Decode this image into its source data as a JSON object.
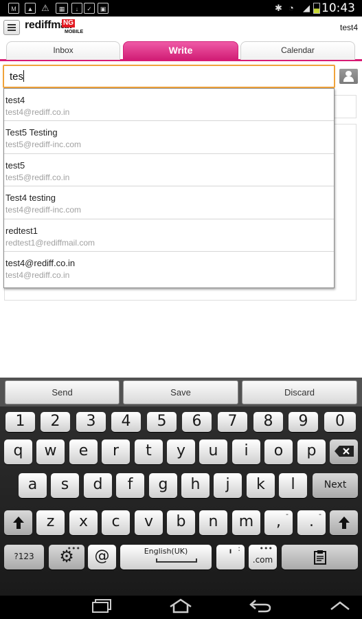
{
  "status_bar": {
    "time": "10:43",
    "icons_left": [
      "gmail-icon",
      "image-icon",
      "warning-icon",
      "keyboard-icon",
      "download-icon",
      "store-icon"
    ],
    "icons_right": [
      "bluetooth-icon",
      "wifi-icon",
      "signal-icon",
      "battery-icon"
    ]
  },
  "app": {
    "logo_text": "rediffmail",
    "logo_badge": "NG",
    "logo_sub": "MOBILE",
    "user": "test4",
    "brand_color": "#d81b74"
  },
  "tabs": [
    {
      "label": "Inbox",
      "active": false
    },
    {
      "label": "Write",
      "active": true
    },
    {
      "label": "Calendar",
      "active": false
    }
  ],
  "compose": {
    "to_value": "tes"
  },
  "suggestions": [
    {
      "name": "test4",
      "email": "test4@rediff.co.in"
    },
    {
      "name": "Test5 Testing",
      "email": "test5@rediff-inc.com"
    },
    {
      "name": "test5",
      "email": "test5@rediff.co.in"
    },
    {
      "name": "Test4 testing",
      "email": "test4@rediff-inc.com"
    },
    {
      "name": "redtest1",
      "email": "redtest1@rediffmail.com"
    },
    {
      "name": "test4@rediff.co.in",
      "email": "test4@rediff.co.in"
    }
  ],
  "actions": {
    "send": "Send",
    "save": "Save",
    "discard": "Discard"
  },
  "keyboard": {
    "row1": [
      "1",
      "2",
      "3",
      "4",
      "5",
      "6",
      "7",
      "8",
      "9",
      "0"
    ],
    "row2": [
      "q",
      "w",
      "e",
      "r",
      "t",
      "y",
      "u",
      "i",
      "o",
      "p"
    ],
    "row3": [
      "a",
      "s",
      "d",
      "f",
      "g",
      "h",
      "j",
      "k",
      "l"
    ],
    "row3_next": "Next",
    "row4": [
      "z",
      "x",
      "c",
      "v",
      "b",
      "n",
      "m"
    ],
    "comma_key": ",",
    "comma_sup": "-",
    "period_key": ".",
    "period_sup": "-",
    "sym_key": "?123",
    "at_key": "@",
    "space_label": "English(UK)",
    "apostrophe_key": "'",
    "apostrophe_sup": ":",
    "dotcom_key": ".com",
    "dotcom_sup": "•••"
  },
  "nav": {
    "icons": [
      "recent-apps-icon",
      "home-icon",
      "back-icon",
      "hide-keyboard-icon"
    ]
  }
}
